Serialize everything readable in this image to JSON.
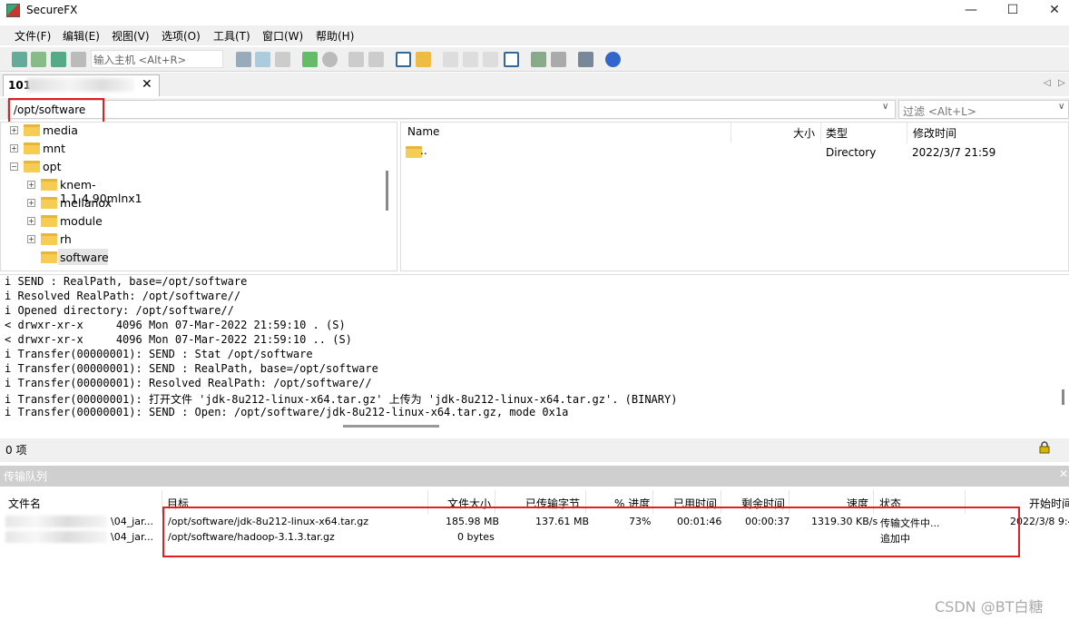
{
  "window": {
    "title": "SecureFX",
    "minimize": "—",
    "maximize": "☐",
    "close": "✕"
  },
  "menu": [
    "文件(F)",
    "编辑(E)",
    "视图(V)",
    "选项(O)",
    "工具(T)",
    "窗口(W)",
    "帮助(H)"
  ],
  "toolbar": {
    "host_placeholder": "输入主机 <Alt+R>"
  },
  "tab": {
    "label": "101",
    "close": "✕"
  },
  "tab_nav": {
    "prev": "◁",
    "next": "▷"
  },
  "path": {
    "value": "/opt/software",
    "filter_placeholder": "过滤 <Alt+L>"
  },
  "tree": [
    {
      "label": "media",
      "level": 1,
      "expander": "+"
    },
    {
      "label": "mnt",
      "level": 1,
      "expander": "+"
    },
    {
      "label": "opt",
      "level": 1,
      "expander": "−"
    },
    {
      "label": "knem-1.1.4.90mlnx1",
      "level": 2,
      "expander": "+"
    },
    {
      "label": "mellanox",
      "level": 2,
      "expander": "+"
    },
    {
      "label": "module",
      "level": 2,
      "expander": "+"
    },
    {
      "label": "rh",
      "level": 2,
      "expander": "+"
    },
    {
      "label": "software",
      "level": 2,
      "expander": "",
      "selected": true
    }
  ],
  "file_list": {
    "headers": {
      "name": "Name",
      "size": "大小",
      "type": "类型",
      "modified": "修改时间"
    },
    "rows": [
      {
        "name": "..",
        "size": "",
        "type": "Directory",
        "modified": "2022/3/7 21:59"
      }
    ]
  },
  "log": [
    "i SEND : RealPath, base=/opt/software",
    "i Resolved RealPath: /opt/software//",
    "i Opened directory: /opt/software//",
    "< drwxr-xr-x     4096 Mon 07-Mar-2022 21:59:10 . (S)",
    "< drwxr-xr-x     4096 Mon 07-Mar-2022 21:59:10 .. (S)",
    "i Transfer(00000001): SEND : Stat /opt/software",
    "i Transfer(00000001): SEND : RealPath, base=/opt/software",
    "i Transfer(00000001): Resolved RealPath: /opt/software//",
    "i Transfer(00000001): 打开文件 'jdk-8u212-linux-x64.tar.gz' 上传为 'jdk-8u212-linux-x64.tar.gz'. (BINARY)",
    "i Transfer(00000001): SEND : Open: /opt/software/jdk-8u212-linux-x64.tar.gz, mode 0x1a"
  ],
  "status": {
    "items": "0 项"
  },
  "queue": {
    "title": "传输队列",
    "close": "✕",
    "headers": {
      "filename": "文件名",
      "target": "目标",
      "size": "文件大小",
      "transferred": "已传输字节",
      "progress": "% 进度",
      "elapsed": "已用时间",
      "remaining": "剩余时间",
      "speed": "速度",
      "state": "状态",
      "start": "开始时间"
    },
    "rows": [
      {
        "filename": "\\04_jar...",
        "target": "/opt/software/jdk-8u212-linux-x64.tar.gz",
        "size": "185.98 MB",
        "transferred": "137.61 MB",
        "progress": "73%",
        "elapsed": "00:01:46",
        "remaining": "00:00:37",
        "speed": "1319.30 KB/s",
        "state": "传输文件中...",
        "start": "2022/3/8 9:4"
      },
      {
        "filename": "\\04_jar...",
        "target": "/opt/software/hadoop-3.1.3.tar.gz",
        "size": "0 bytes",
        "transferred": "",
        "progress": "",
        "elapsed": "",
        "remaining": "",
        "speed": "",
        "state": "追加中",
        "start": ""
      }
    ]
  },
  "watermark": "CSDN @BT白糖",
  "colors": {
    "highlight_border": "#e02020",
    "folder": "#f6cd52",
    "queue_header": "#cfcfcf"
  }
}
